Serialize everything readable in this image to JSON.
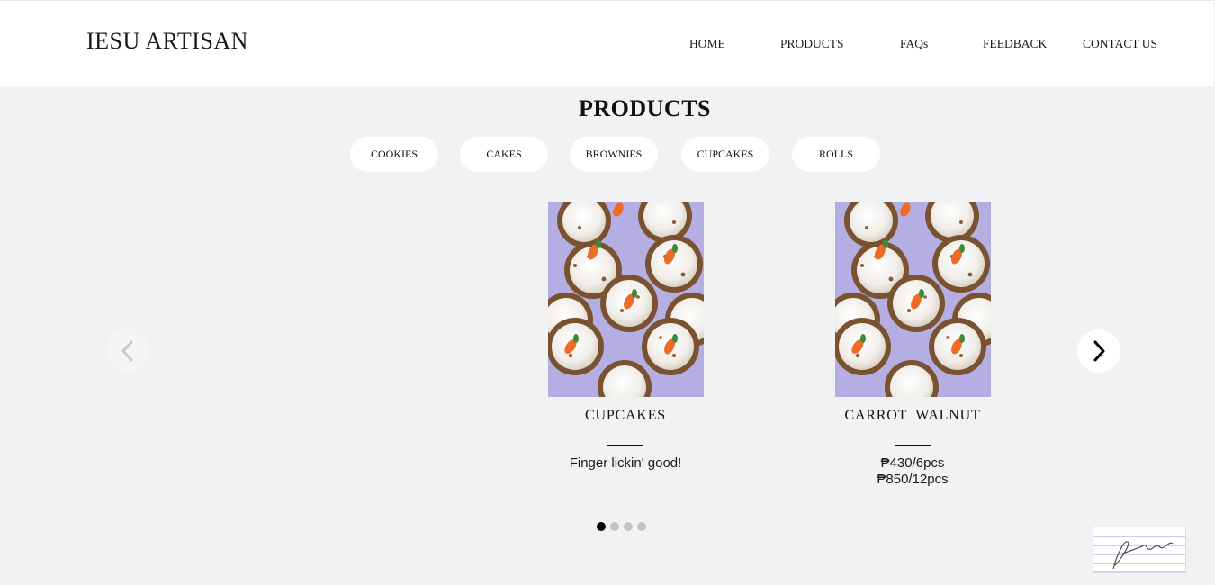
{
  "header": {
    "brand": "IESU ARTISAN",
    "nav": [
      {
        "label": "HOME"
      },
      {
        "label": "PRODUCTS"
      },
      {
        "label": "FAQs"
      },
      {
        "label": "FEEDBACK"
      },
      {
        "label": "CONTACT US"
      }
    ]
  },
  "products": {
    "title": "PRODUCTS",
    "filters": [
      "COOKIES",
      "CAKES",
      "BROWNIES",
      "CUPCAKES",
      "ROLLS"
    ],
    "cards": [
      {
        "title": "CUPCAKES",
        "description": "Finger lickin' good!",
        "image": "carrot-cupcakes-photo"
      },
      {
        "title": "CARROT  WALNUT",
        "price_lines": [
          "₱430/6pcs",
          "₱850/12pcs"
        ],
        "image": "carrot-cupcakes-photo"
      }
    ]
  },
  "carousel": {
    "prev_icon": "chevron-left-icon",
    "next_icon": "chevron-right-icon",
    "page_count": 4,
    "active_page": 1
  },
  "colors": {
    "page_background": "#f1f2f4",
    "header_background": "#ffffff",
    "pill_background": "#ffffff",
    "dot_active": "#000000",
    "dot_inactive": "#c4c4c4"
  }
}
